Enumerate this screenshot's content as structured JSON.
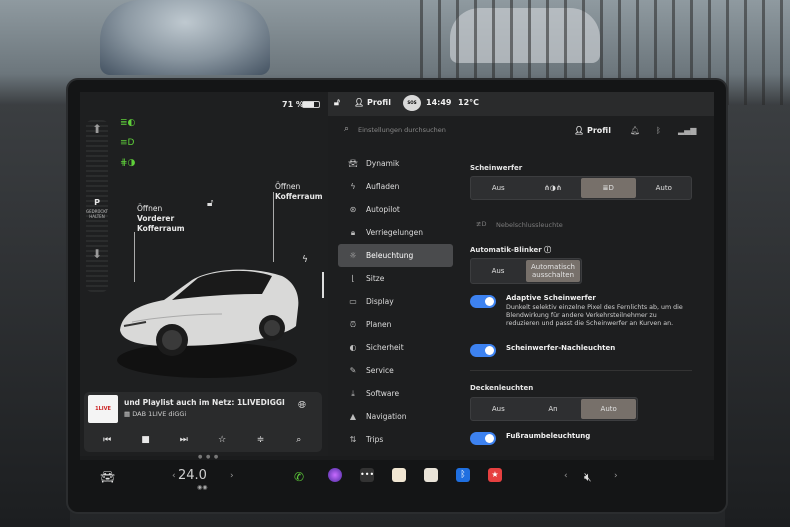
{
  "status": {
    "battery_percent": "71 %",
    "battery_level": 0.71,
    "profile_label": "Profil",
    "time": "14:49",
    "temperature": "12°C",
    "sos_label": "SOS"
  },
  "vehicle": {
    "front_trunk_label_1": "Öffnen",
    "front_trunk_label_2": "Vorderer",
    "front_trunk_label_3": "Kofferraum",
    "rear_trunk_label_1": "Öffnen",
    "rear_trunk_label_2": "Kofferraum",
    "gear_selected": "P",
    "gear_hold_text": "GEDRÜCKT HALTEN"
  },
  "media": {
    "thumb_text": "1LIVE",
    "title": "und Playlist auch im Netz: 1LIVEDIGGI",
    "source": "DAB 1LIVE diGGi"
  },
  "search": {
    "placeholder": "Einstellungen durchsuchen"
  },
  "settings_header": {
    "profile_label": "Profil"
  },
  "menu": {
    "items": [
      {
        "label": "Dynamik",
        "icon": "car-icon"
      },
      {
        "label": "Aufladen",
        "icon": "bolt-icon"
      },
      {
        "label": "Autopilot",
        "icon": "steering-wheel-icon"
      },
      {
        "label": "Verriegelungen",
        "icon": "lock-icon"
      },
      {
        "label": "Beleuchtung",
        "icon": "sun-icon"
      },
      {
        "label": "Sitze",
        "icon": "seat-icon"
      },
      {
        "label": "Display",
        "icon": "display-icon"
      },
      {
        "label": "Planen",
        "icon": "clock-icon"
      },
      {
        "label": "Sicherheit",
        "icon": "shield-icon"
      },
      {
        "label": "Service",
        "icon": "wrench-icon"
      },
      {
        "label": "Software",
        "icon": "download-icon"
      },
      {
        "label": "Navigation",
        "icon": "navigation-icon"
      },
      {
        "label": "Trips",
        "icon": "trips-icon"
      }
    ],
    "active_index": 4
  },
  "lighting": {
    "headlights_title": "Scheinwerfer",
    "headlights_options": [
      "Aus",
      "",
      "",
      "Auto"
    ],
    "headlights_selected": 2,
    "fog_label": "Nebelschlussleuchte",
    "auto_blinker_title": "Automatik-Blinker",
    "auto_blinker_options": [
      "Aus",
      "Automatisch ausschalten"
    ],
    "auto_blinker_selected": 1,
    "adaptive_title": "Adaptive Scheinwerfer",
    "adaptive_desc": "Dunkelt selektiv einzelne Pixel des Fernlichts ab, um die Blendwirkung für andere Verkehrsteilnehmer zu reduzieren und passt die Scheinwerfer an Kurven an.",
    "adaptive_on": true,
    "follow_title": "Scheinwerfer-Nachleuchten",
    "follow_on": true,
    "ceiling_title": "Deckenleuchten",
    "ceiling_options": [
      "Aus",
      "An",
      "Auto"
    ],
    "ceiling_selected": 2,
    "footwell_title": "Fußraumbeleuchtung",
    "footwell_on": true
  },
  "taskbar": {
    "temperature": "24.0",
    "accent_green": "#5fcf3a",
    "toggle_blue": "#3d82f0"
  }
}
